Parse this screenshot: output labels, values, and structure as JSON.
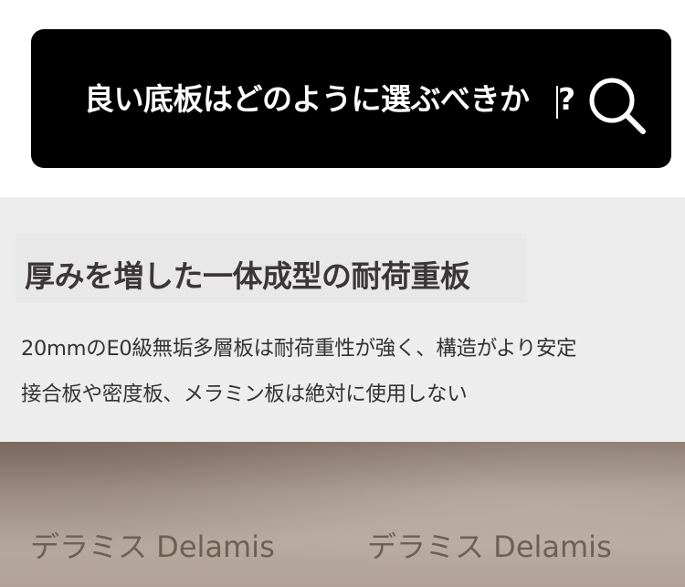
{
  "search": {
    "query_text": "良い底板はどのように選ぶべきか",
    "query_suffix": "?",
    "icon": "search-icon"
  },
  "feature": {
    "heading": "厚みを増した一体成型の耐荷重板",
    "description_line1": "20mmのE0級無垢多層板は耐荷重性が強く、構造がより安定",
    "description_line2": "接合板や密度板、メラミン板は絶対に使用しない"
  },
  "watermarks": [
    {
      "text": "デラミス Delamis"
    },
    {
      "text": "デラミス Delamis"
    }
  ],
  "colors": {
    "search_bar_bg": "#000000",
    "panel_bg": "#eeedee",
    "heading_text": "#3b3637",
    "photo_tone": "#aa9b90"
  }
}
